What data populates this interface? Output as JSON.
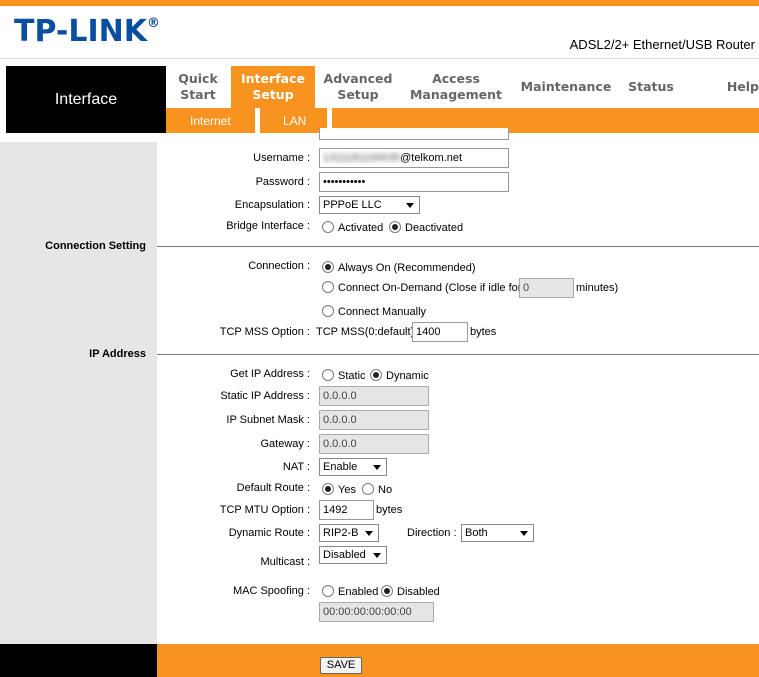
{
  "header": {
    "logo": "TP-LINK",
    "logo_mark": "®",
    "model": "ADSL2/2+ Ethernet/USB Router"
  },
  "nav": {
    "title": "Interface",
    "items": [
      {
        "line1": "Quick",
        "line2": "Start"
      },
      {
        "line1": "Interface",
        "line2": "Setup"
      },
      {
        "line1": "Advanced",
        "line2": "Setup"
      },
      {
        "line1": "Access",
        "line2": "Management"
      },
      {
        "line1": "Maintenance",
        "line2": ""
      },
      {
        "line1": "Status",
        "line2": ""
      },
      {
        "line1": "Help",
        "line2": ""
      }
    ],
    "subitems": [
      "Internet",
      "LAN"
    ]
  },
  "sections": {
    "connection_setting": "Connection Setting",
    "ip_address": "IP Address"
  },
  "form": {
    "username_label": "Username :",
    "username_hidden": "1311181100035",
    "username_suffix": "@telkom.net",
    "password_label": "Password :",
    "password_value": "•••••••••••",
    "encapsulation_label": "Encapsulation :",
    "encapsulation_value": "PPPoE LLC",
    "bridge_label": "Bridge Interface :",
    "bridge_activated": "Activated",
    "bridge_deactivated": "Deactivated",
    "connection_label": "Connection :",
    "always_on": "Always On (Recommended)",
    "on_demand": "Connect On-Demand (Close if idle for",
    "idle_value": "0",
    "minutes": "minutes)",
    "manually": "Connect Manually",
    "tcp_mss_label": "TCP MSS Option :",
    "tcp_mss_text": "TCP MSS(0:default)",
    "tcp_mss_value": "1400",
    "bytes": "bytes",
    "get_ip_label": "Get IP Address :",
    "static": "Static",
    "dynamic": "Dynamic",
    "static_ip_label": "Static IP Address :",
    "static_ip_value": "0.0.0.0",
    "subnet_label": "IP Subnet Mask :",
    "subnet_value": "0.0.0.0",
    "gateway_label": "Gateway :",
    "gateway_value": "0.0.0.0",
    "nat_label": "NAT :",
    "nat_value": "Enable",
    "default_route_label": "Default Route :",
    "yes": "Yes",
    "no": "No",
    "tcp_mtu_label": "TCP MTU Option :",
    "tcp_mtu_value": "1492",
    "mtu_bytes": "bytes",
    "dynamic_route_label": "Dynamic Route :",
    "dynamic_route_value": "RIP2-B",
    "direction_label": "Direction :",
    "direction_value": "Both",
    "multicast_label": "Multicast :",
    "multicast_value": "Disabled",
    "mac_spoofing_label": "MAC Spoofing :",
    "mac_enabled": "Enabled",
    "mac_disabled": "Disabled",
    "mac_value": "00:00:00:00:00:00"
  },
  "footer": {
    "save": "SAVE"
  },
  "colors": {
    "accent": "#f7931e",
    "logo": "#0a4f9f",
    "nav_black": "#000000",
    "left_column": "#e6e6e6"
  }
}
